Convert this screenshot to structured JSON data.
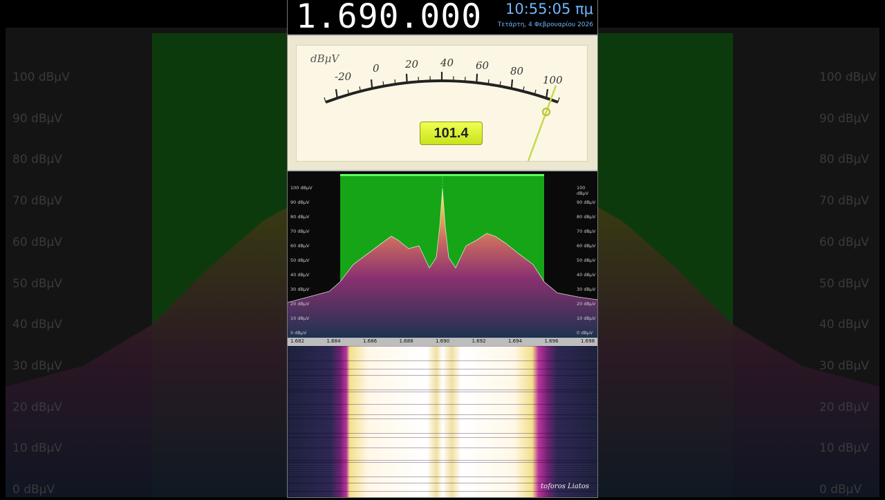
{
  "header": {
    "frequency": "1.690.000",
    "time": "10:55:05 πμ",
    "date": "Τετάρτη, 4 Φεβρουαρίου 2026"
  },
  "meter": {
    "unit": "dBμV",
    "scale": [
      "-20",
      "0",
      "20",
      "40",
      "60",
      "80",
      "100"
    ],
    "readout": "101.4",
    "value": 101.4
  },
  "spectrum": {
    "db_labels": [
      "100 dBμV",
      "90 dBμV",
      "80 dBμV",
      "70 dBμV",
      "60 dBμV",
      "50 dBμV",
      "40 dBμV",
      "30 dBμV",
      "20 dBμV",
      "10 dBμV",
      "0 dBμV"
    ],
    "freq_ticks": [
      "1.682",
      "1.684",
      "1.686",
      "1.688",
      "1.690",
      "1.692",
      "1.694",
      "1.696",
      "1.698"
    ],
    "passband_color": "#2fb82f"
  },
  "background": {
    "db_labels": [
      "100 dBμV",
      "90 dBμV",
      "80 dBμV",
      "70 dBμV",
      "60 dBμV",
      "50 dBμV",
      "40 dBμV",
      "30 dBμV",
      "20 dBμV",
      "10 dBμV",
      "0 dBμV"
    ]
  },
  "waterfall": {
    "credit": "toforos Liatos"
  }
}
